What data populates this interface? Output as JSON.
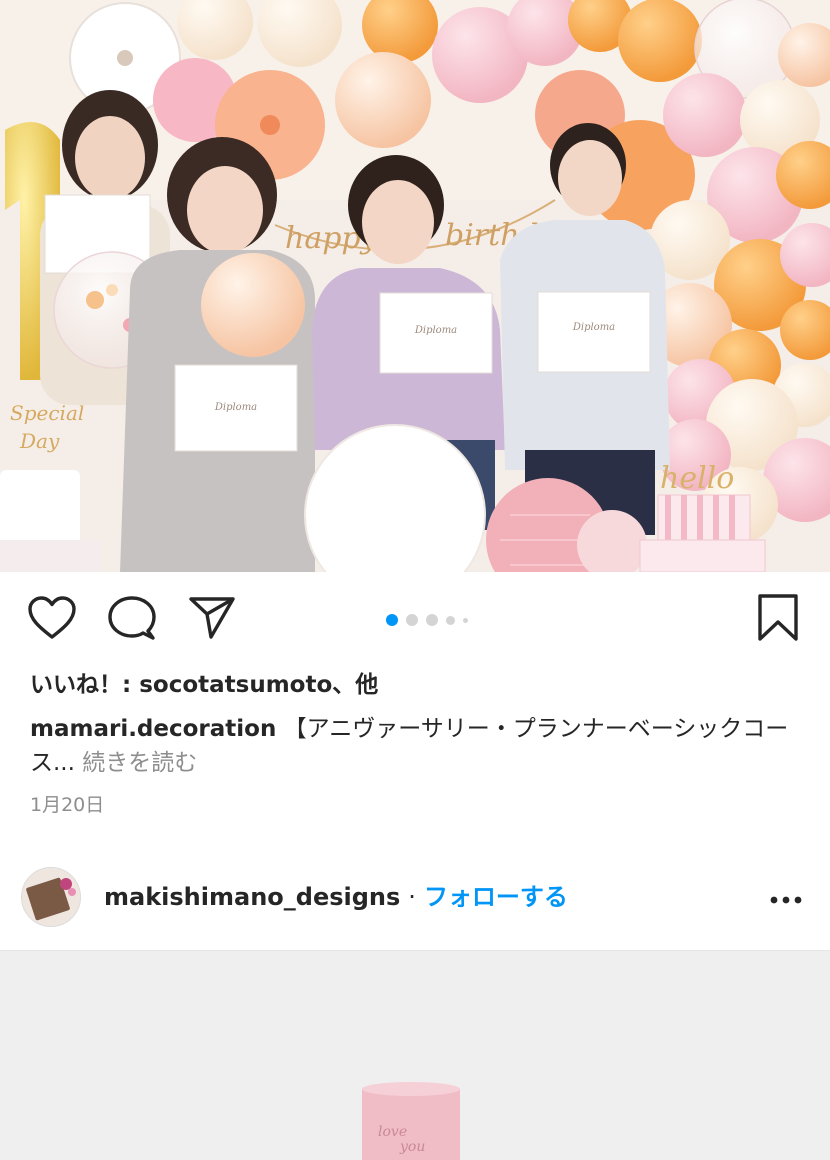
{
  "post": {
    "photo": {
      "label": "celebration-group-photo"
    },
    "carousel": {
      "total": 5,
      "active_index": 0
    },
    "likes_text": "いいね！: socotatsumoto、他",
    "caption_user": "mamari.decoration",
    "caption_text": " 【アニヴァーサリー・プランナーベーシックコース...",
    "caption_more": " 続きを読む",
    "date": "1月20日"
  },
  "next_post": {
    "username": "makishimano_designs",
    "separator": "·",
    "follow_label": "フォローする",
    "more_label": "•••"
  },
  "icons": {
    "like": "heart-icon",
    "comment": "comment-icon",
    "share": "send-icon",
    "save": "bookmark-icon",
    "more": "ellipsis-icon"
  },
  "colors": {
    "accent": "#0095f6",
    "text": "#262626",
    "muted": "#8e8e8e",
    "dot_inactive": "#d4d4d4"
  }
}
